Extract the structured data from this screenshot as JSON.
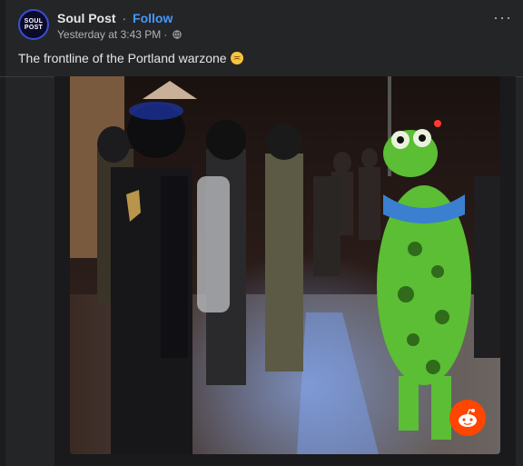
{
  "post": {
    "page_name": "Soul Post",
    "separator": "·",
    "follow_label": "Follow",
    "timestamp": "Yesterday at 3:43 PM",
    "meta_separator": "·",
    "privacy_icon": "globe-icon",
    "avatar_text_line1": "SOUL",
    "avatar_text_line2": "POST",
    "more_icon": "more-options-icon",
    "caption": "The frontline of the Portland warzone",
    "caption_emoji": "upside-down-face-emoji"
  },
  "media": {
    "watermark_icon": "reddit-icon",
    "colors": {
      "accent_blue": "#4599ff",
      "reddit_orange": "#ff4500"
    }
  }
}
